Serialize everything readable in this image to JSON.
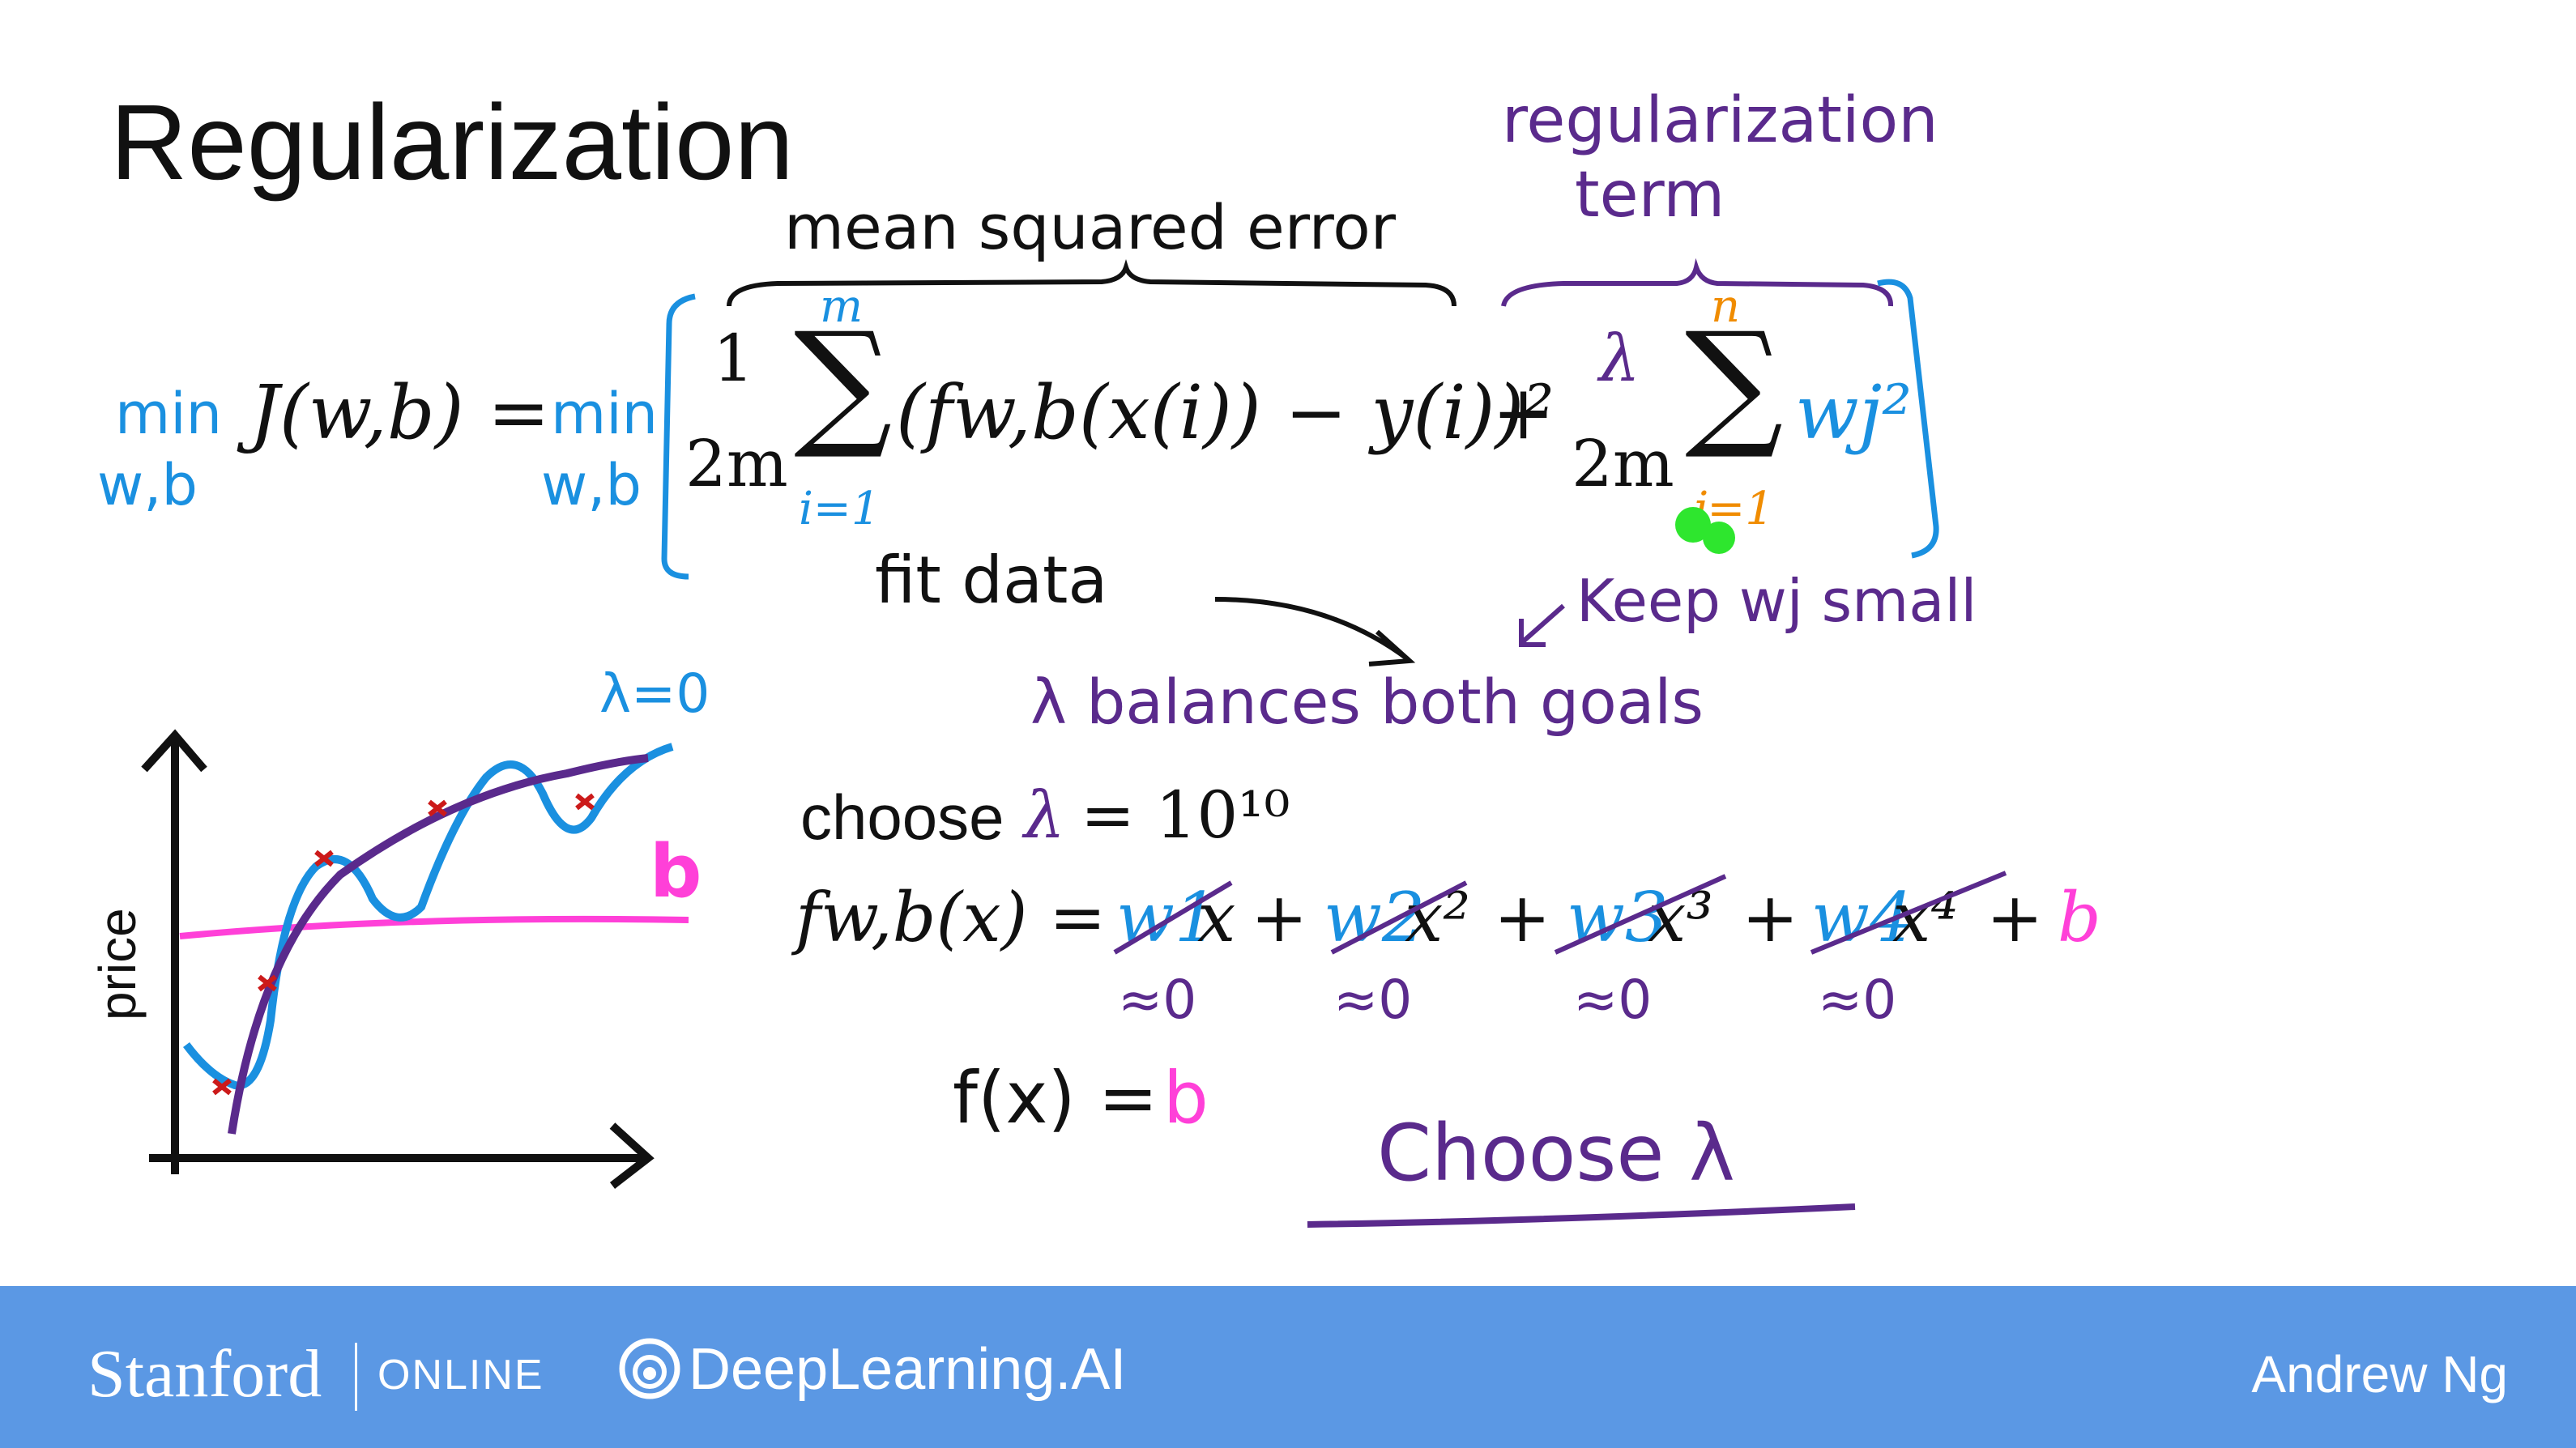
{
  "slide": {
    "title": "Regularization",
    "annotations": {
      "mean_squared_error": "mean squared error",
      "regularization_term_line1": "regularization",
      "regularization_term_line2": "term",
      "min_left": "min",
      "min_left_sub": "w,b",
      "min_right": "min",
      "min_right_sub": "w,b",
      "fit_data": "fit data",
      "keep_wj_small": "Keep wj small",
      "lambda_balances": "λ balances both goals",
      "lambda_zero": "λ=0",
      "b_label": "b",
      "approx_zero": "≈0",
      "f_of_x_equals": "f(x) =",
      "f_of_x_b": "b",
      "choose_lambda": "Choose λ"
    },
    "equation": {
      "J": "J(w,b) =",
      "frac1_num": "1",
      "frac1_den": "2m",
      "sum1_top": "m",
      "sum1_bottom": "i=1",
      "loss_term": "(fw,b(x(i)) − y(i))²",
      "plus": "+",
      "frac2_num": "λ",
      "frac2_den": "2m",
      "sum2_top": "n",
      "sum2_bottom": "j=1",
      "w_j_sq": "wj²"
    },
    "choose_line": {
      "prefix": "choose",
      "lambda": "λ",
      "equals": "= 10¹⁰"
    },
    "f_line": {
      "lhs": "fw,b(x) =",
      "w1": "w1",
      "x1": "x",
      "w2": "w2",
      "x2": "x²",
      "w3": "w3",
      "x3": "x³",
      "w4": "w4",
      "x4": "x⁴",
      "plus": "+",
      "b": "b"
    },
    "chart": {
      "ylabel": "price"
    }
  },
  "footer": {
    "stanford": "Stanford",
    "online": "ONLINE",
    "deeplearning": "DeepLearning.AI",
    "author": "Andrew Ng"
  },
  "colors": {
    "blue": "#1a90e0",
    "purple": "#5a2a8c",
    "orange": "#f08c00",
    "pink": "#ff40d8",
    "footer": "#5b98e4"
  }
}
